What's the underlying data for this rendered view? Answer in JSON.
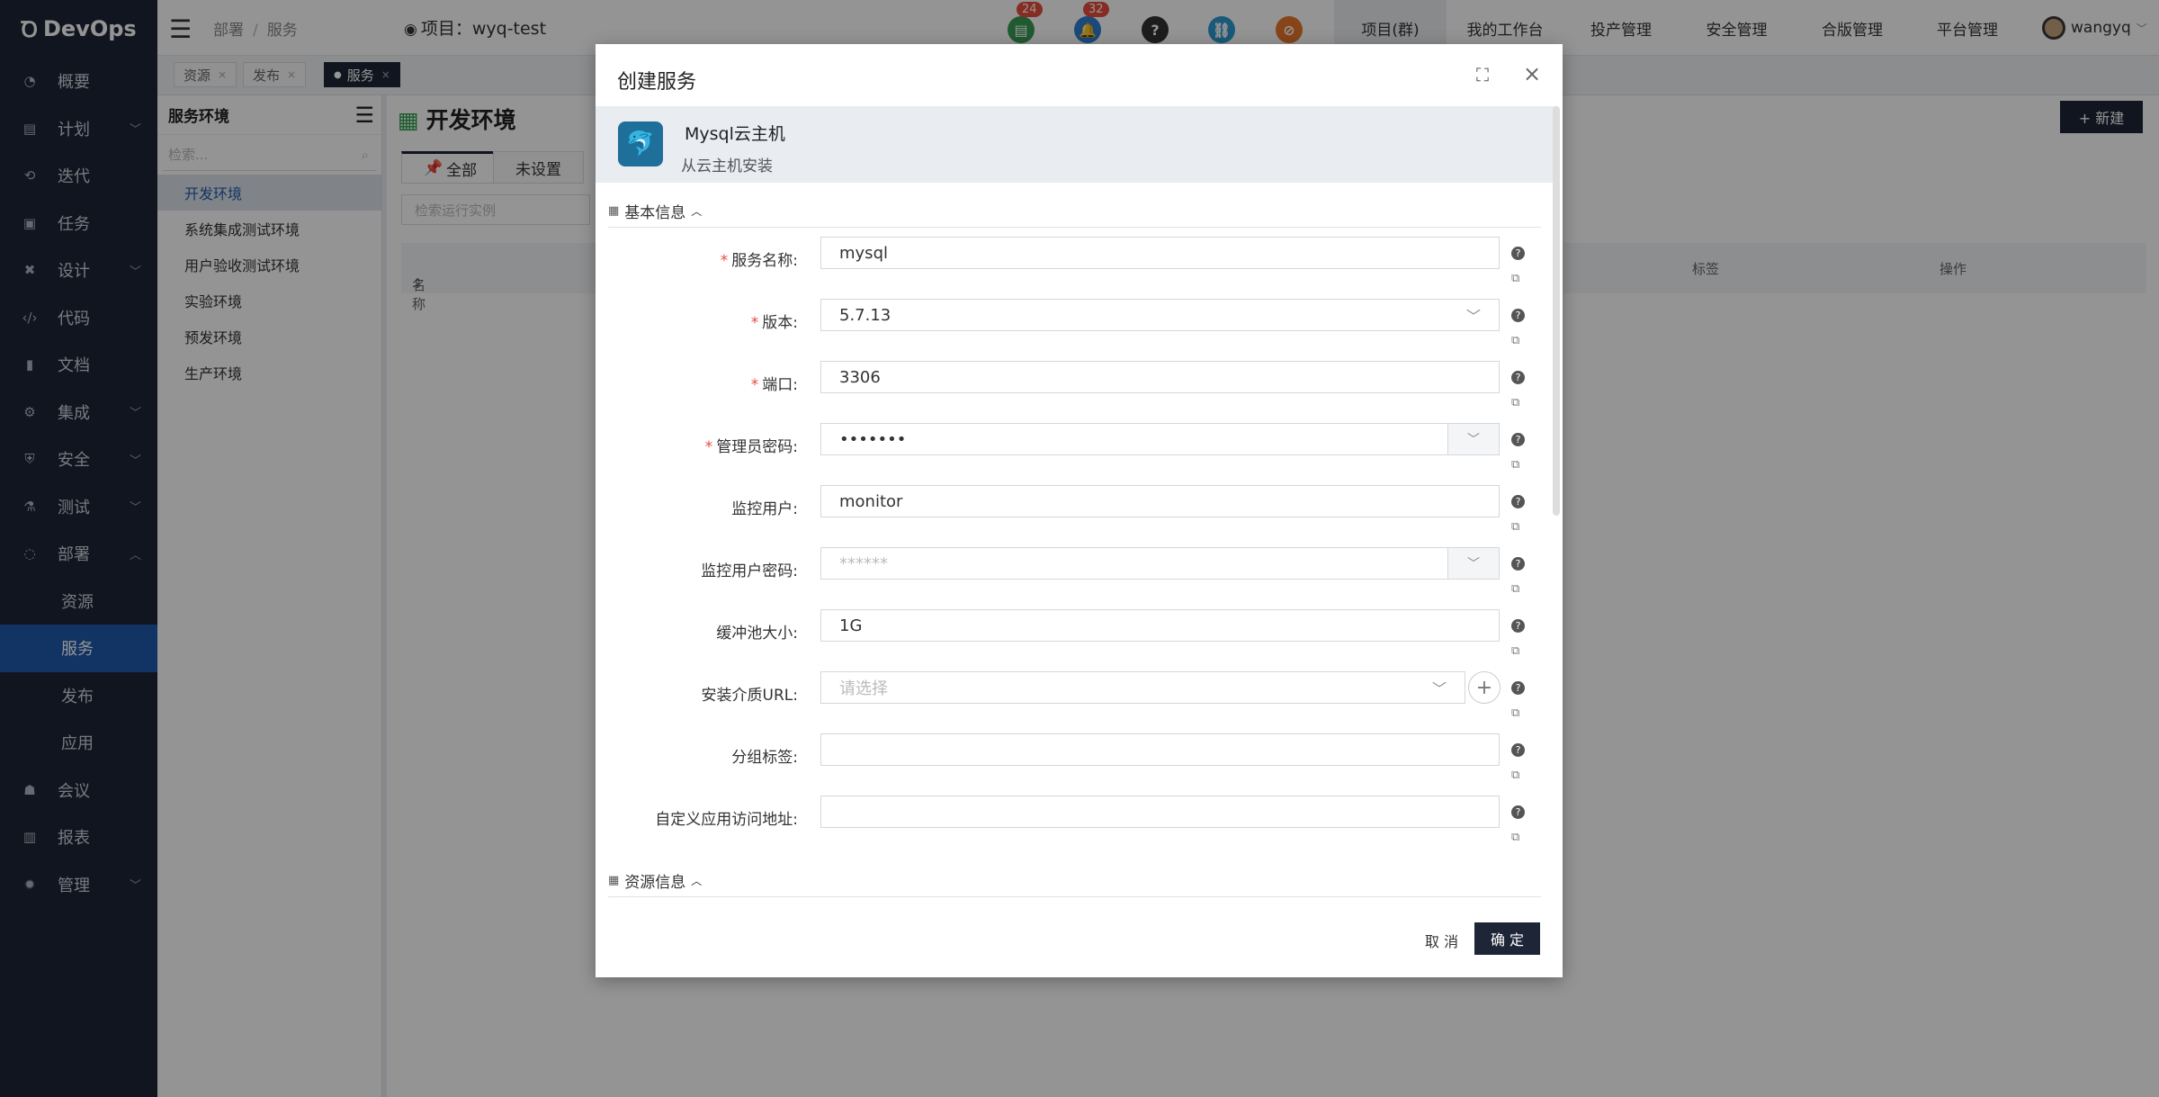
{
  "app": {
    "logo": "DevOps"
  },
  "sidebar": {
    "items": [
      {
        "label": "概要",
        "icon": "dashboard-icon"
      },
      {
        "label": "计划",
        "icon": "plan-icon",
        "chevron": "down"
      },
      {
        "label": "迭代",
        "icon": "iteration-icon"
      },
      {
        "label": "任务",
        "icon": "task-icon"
      },
      {
        "label": "设计",
        "icon": "design-icon",
        "chevron": "down"
      },
      {
        "label": "代码",
        "icon": "code-icon"
      },
      {
        "label": "文档",
        "icon": "document-icon"
      },
      {
        "label": "集成",
        "icon": "integration-icon",
        "chevron": "down"
      },
      {
        "label": "安全",
        "icon": "shield-icon",
        "chevron": "down"
      },
      {
        "label": "测试",
        "icon": "flask-icon",
        "chevron": "down"
      },
      {
        "label": "部署",
        "icon": "deploy-icon",
        "chevron": "up"
      }
    ],
    "sub_items": [
      {
        "label": "资源"
      },
      {
        "label": "服务",
        "active": true
      },
      {
        "label": "发布"
      },
      {
        "label": "应用"
      }
    ],
    "bottom_items": [
      {
        "label": "会议",
        "icon": "meeting-icon"
      },
      {
        "label": "报表",
        "icon": "report-icon"
      },
      {
        "label": "管理",
        "icon": "gear-icon",
        "chevron": "down"
      }
    ]
  },
  "topbar": {
    "breadcrumb": [
      "部署",
      "服务"
    ],
    "project": "项目：wyq-test",
    "badge_docs": "24",
    "badge_bell": "32",
    "menu": [
      "项目(群)",
      "我的工作台",
      "投产管理",
      "安全管理",
      "合版管理",
      "平台管理"
    ],
    "user": "wangyq"
  },
  "page_tabs": [
    {
      "label": "资源"
    },
    {
      "label": "发布"
    },
    {
      "label": "服务",
      "active": true
    }
  ],
  "left_panel": {
    "title": "服务环境",
    "search_placeholder": "检索...",
    "items": [
      "开发环境",
      "系统集成测试环境",
      "用户验收测试环境",
      "实验环境",
      "预发环境",
      "生产环境"
    ]
  },
  "main": {
    "title": "开发环境",
    "new_button": "+ 新建",
    "tabs": [
      "全部",
      "未设置"
    ],
    "search_placeholder": "检索运行实例",
    "columns": [
      "名称",
      "标签",
      "操作"
    ]
  },
  "modal": {
    "title": "创建服务",
    "service_name": "Mysql云主机",
    "service_desc": "从云主机安装",
    "section_basic": "基本信息",
    "section_resource": "资源信息",
    "fields": [
      {
        "label": "服务名称:",
        "required": true,
        "value": "mysql"
      },
      {
        "label": "版本:",
        "required": true,
        "value": "5.7.13"
      },
      {
        "label": "端口:",
        "required": true,
        "value": "3306"
      },
      {
        "label": "管理员密码:",
        "required": true,
        "value": "•••••••"
      },
      {
        "label": "监控用户:",
        "required": false,
        "value": "monitor"
      },
      {
        "label": "监控用户密码:",
        "required": false,
        "placeholder": "******"
      },
      {
        "label": "缓冲池大小:",
        "required": false,
        "value": "1G"
      },
      {
        "label": "安装介质URL:",
        "required": false,
        "placeholder": "请选择"
      },
      {
        "label": "分组标签:",
        "required": false,
        "value": ""
      },
      {
        "label": "自定义应用访问地址:",
        "required": false,
        "value": ""
      }
    ],
    "cancel": "取 消",
    "ok": "确 定"
  },
  "colors": {
    "sidebar_bg": "#1e2536",
    "active_blue": "#1f5aad",
    "primary_btn": "#1e2536",
    "required": "#e74c3c"
  }
}
